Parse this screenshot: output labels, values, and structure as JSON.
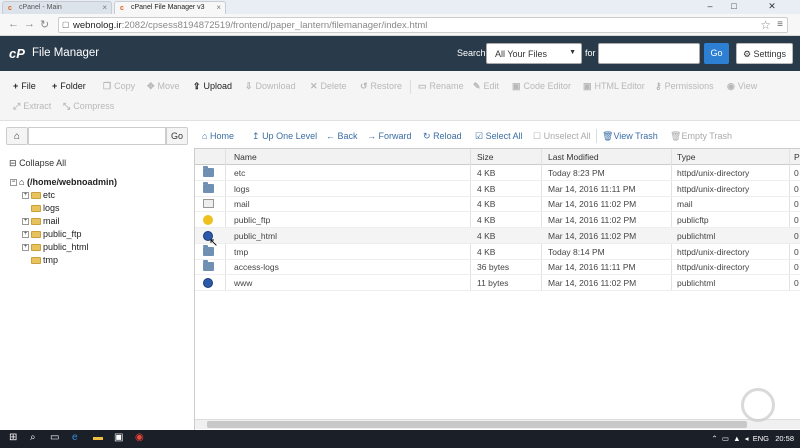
{
  "browser": {
    "tabs": [
      {
        "label": "cPanel - Main",
        "close": "×"
      },
      {
        "label": "cPanel File Manager v3",
        "close": "×"
      }
    ],
    "window_controls": {
      "minimize": "–",
      "maximize": "□",
      "close": "✕"
    },
    "url_host": "webnolog.ir",
    "url_rest": ":2082/cpsess8194872519/frontend/paper_lantern/filemanager/index.html"
  },
  "header": {
    "logo": "cP",
    "title": "File Manager",
    "search_label": "Search",
    "search_scope": "All Your Files",
    "for_label": "for",
    "go_label": "Go",
    "settings_label": "Settings"
  },
  "toolbar": {
    "file": "File",
    "folder": "Folder",
    "copy": "Copy",
    "move": "Move",
    "upload": "Upload",
    "download": "Download",
    "delete": "Delete",
    "restore": "Restore",
    "rename": "Rename",
    "edit": "Edit",
    "code_editor": "Code Editor",
    "html_editor": "HTML Editor",
    "permissions": "Permissions",
    "view": "View",
    "extract": "Extract",
    "compress": "Compress"
  },
  "pathbar": {
    "go_label": "Go",
    "home": "Home",
    "up_one_level": "Up One Level",
    "back": "Back",
    "forward": "Forward",
    "reload": "Reload",
    "select_all": "Select All",
    "unselect_all": "Unselect All",
    "view_trash": "View Trash",
    "empty_trash": "Empty Trash"
  },
  "tree": {
    "collapse_all": "Collapse All",
    "root": "(/home/webnoadmin)",
    "items": [
      "etc",
      "logs",
      "mail",
      "public_ftp",
      "public_html",
      "tmp"
    ]
  },
  "table": {
    "columns": [
      "Name",
      "Size",
      "Last Modified",
      "Type",
      "P"
    ],
    "rows": [
      {
        "name": "etc",
        "size": "4 KB",
        "modified": "Today 8:23 PM",
        "type": "httpd/unix-directory",
        "perm": "0",
        "icon": "folder-icon"
      },
      {
        "name": "logs",
        "size": "4 KB",
        "modified": "Mar 14, 2016 11:11 PM",
        "type": "httpd/unix-directory",
        "perm": "0",
        "icon": "folder-icon"
      },
      {
        "name": "mail",
        "size": "4 KB",
        "modified": "Mar 14, 2016 11:02 PM",
        "type": "mail",
        "perm": "0",
        "icon": "mail-icon"
      },
      {
        "name": "public_ftp",
        "size": "4 KB",
        "modified": "Mar 14, 2016 11:02 PM",
        "type": "publicftp",
        "perm": "0",
        "icon": "ftp-icon"
      },
      {
        "name": "public_html",
        "size": "4 KB",
        "modified": "Mar 14, 2016 11:02 PM",
        "type": "publichtml",
        "perm": "0",
        "icon": "globe-icon"
      },
      {
        "name": "tmp",
        "size": "4 KB",
        "modified": "Today 8:14 PM",
        "type": "httpd/unix-directory",
        "perm": "0",
        "icon": "folder-icon"
      },
      {
        "name": "access-logs",
        "size": "36 bytes",
        "modified": "Mar 14, 2016 11:11 PM",
        "type": "httpd/unix-directory",
        "perm": "0",
        "icon": "folder-icon"
      },
      {
        "name": "www",
        "size": "11 bytes",
        "modified": "Mar 14, 2016 11:02 PM",
        "type": "publichtml",
        "perm": "0",
        "icon": "globe-icon"
      }
    ]
  },
  "taskbar": {
    "language": "ENG",
    "time": "20:58"
  },
  "colors": {
    "header_bg": "#293a4a",
    "accent": "#2d7fd4",
    "link": "#3b6ea5"
  }
}
